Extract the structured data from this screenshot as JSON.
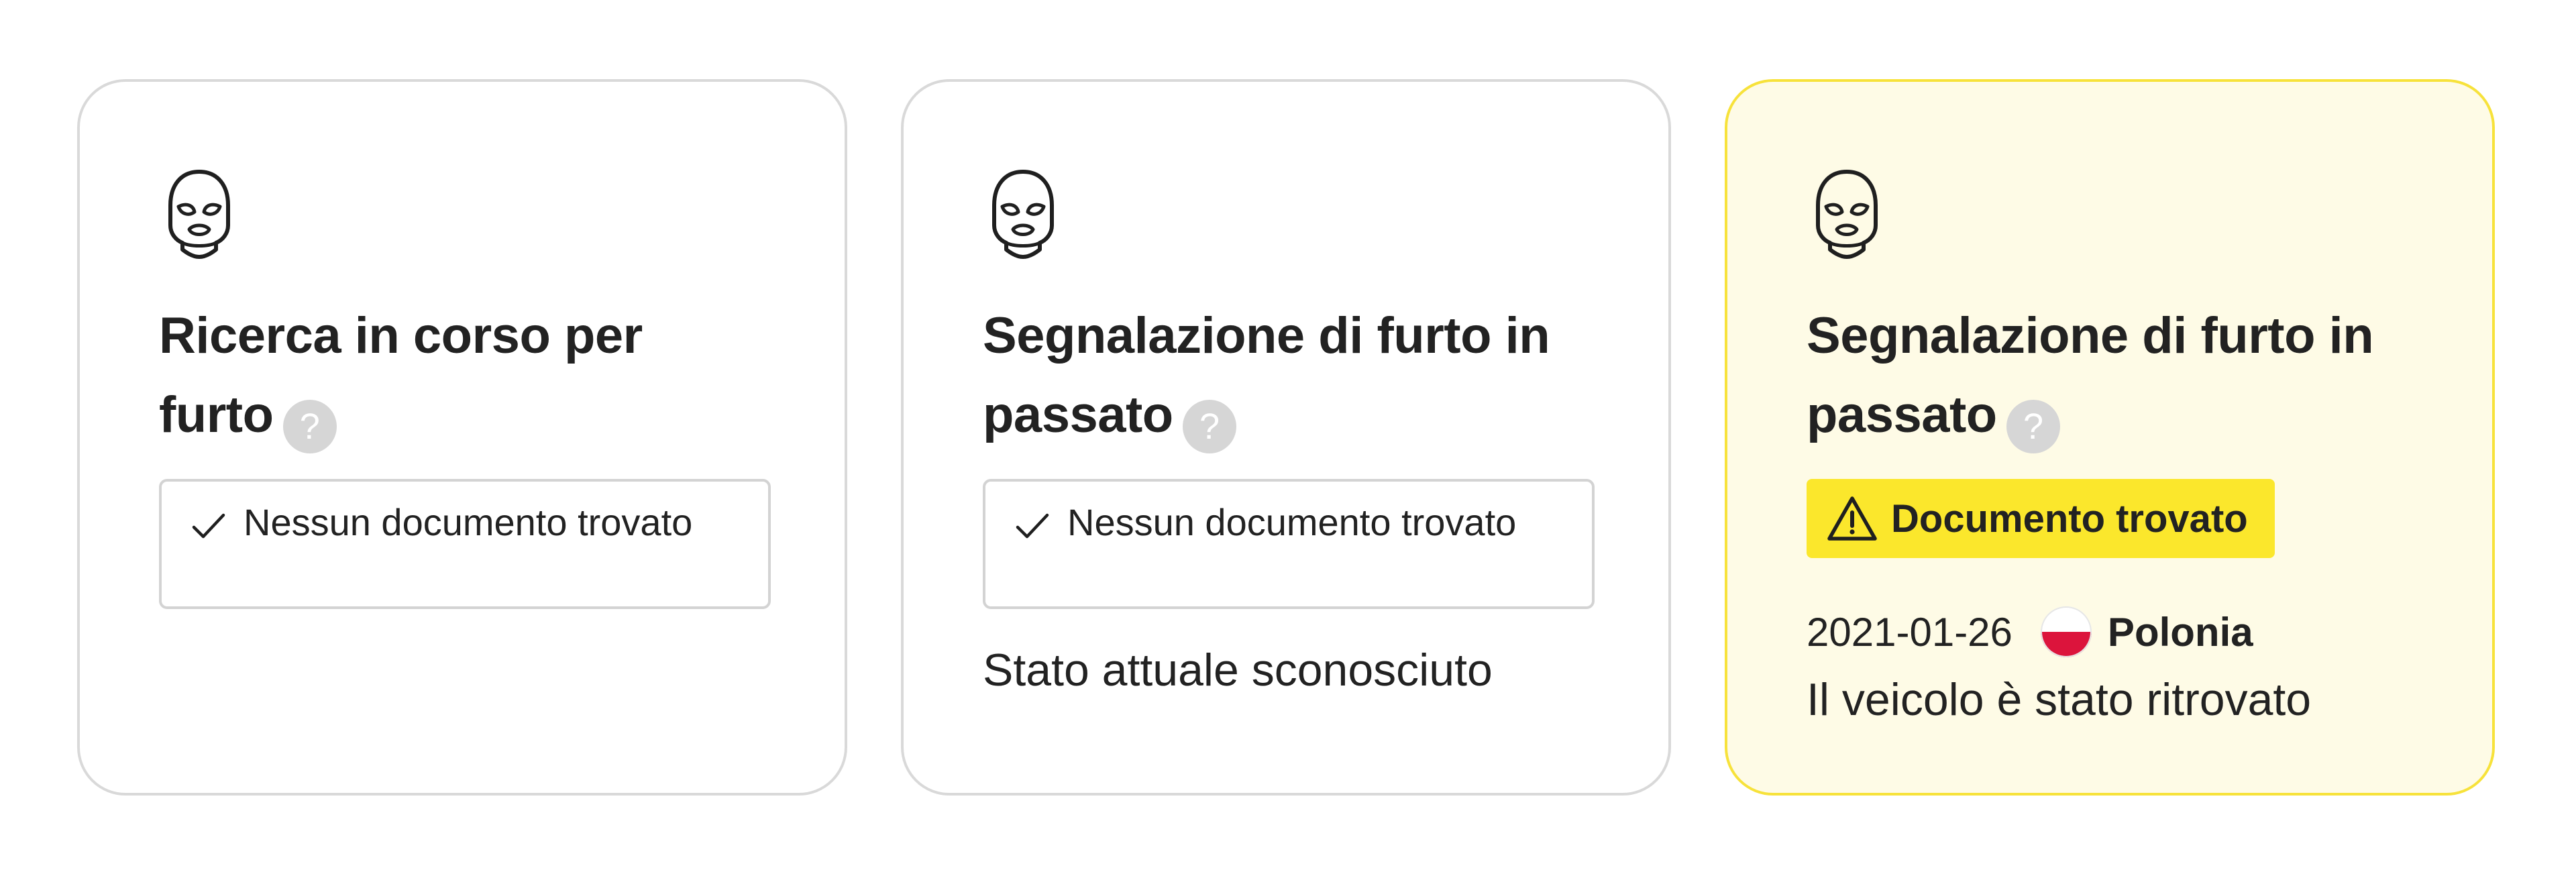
{
  "cards": [
    {
      "icon": "balaclava-icon",
      "title": "Ricerca in corso per furto",
      "help": "?",
      "status": {
        "icon": "check-icon",
        "text": "Nessun documento trovato"
      }
    },
    {
      "icon": "balaclava-icon",
      "title": "Segnalazione di furto in passato",
      "help": "?",
      "status": {
        "icon": "check-icon",
        "text": "Nessun documento trovato"
      },
      "note": "Stato attuale sconosciuto"
    },
    {
      "icon": "balaclava-icon",
      "title": "Segnalazione di furto in passato",
      "help": "?",
      "badge": {
        "icon": "warning-icon",
        "text": "Documento trovato",
        "color": "#fbe72c"
      },
      "date": "2021-01-26",
      "country": "Polonia",
      "flag": "poland-flag-icon",
      "result": "Il veicolo è stato ritrovato"
    }
  ],
  "colors": {
    "alert_card_bg": "#fefbe6",
    "alert_card_border": "#f7e23b",
    "card_border": "#d9d9d9",
    "help_icon": "#d6d6d6"
  }
}
